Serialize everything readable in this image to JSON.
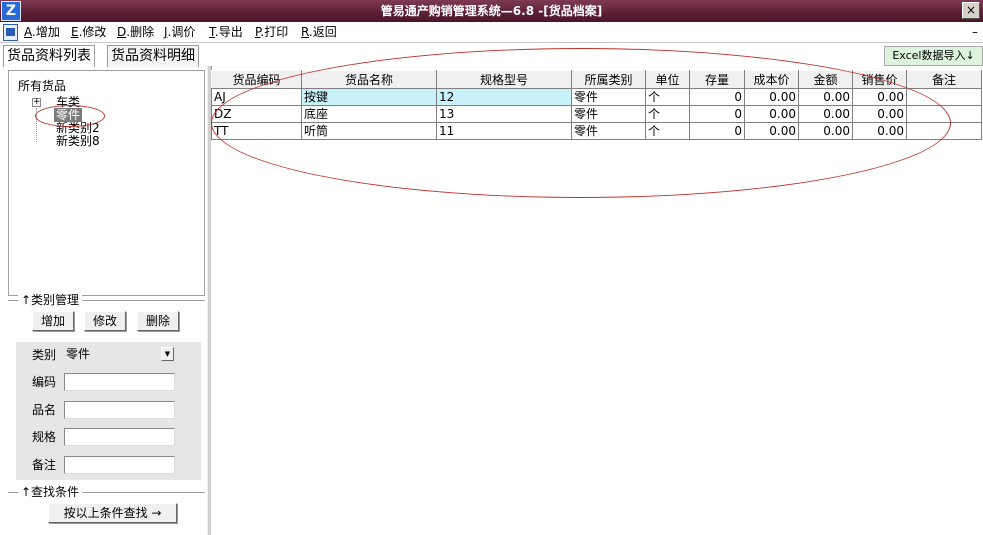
{
  "window": {
    "title": "管易通产购销管理系统—6.8 -[货品档案]",
    "close_label": "×",
    "minimize_label": "–"
  },
  "menu": [
    {
      "hot": "A",
      "label": ".增加"
    },
    {
      "hot": "E",
      "label": ".修改"
    },
    {
      "hot": "D",
      "label": ".删除"
    },
    {
      "hot": "J",
      "label": ".调价"
    },
    {
      "hot": "T",
      "label": ".导出"
    },
    {
      "hot": "P",
      "label": ".打印"
    },
    {
      "hot": "R",
      "label": ".返回"
    }
  ],
  "tabs": [
    {
      "label": "货品资料列表",
      "active": true
    },
    {
      "label": "货品资料明细",
      "active": false
    }
  ],
  "excel_import": "Excel数据导入↓",
  "tree": {
    "root": "所有货品",
    "expander": "+",
    "nodes": [
      "车类",
      "零件",
      "新类别2",
      "新类别8"
    ]
  },
  "category_mgmt": {
    "legend": "↑类别管理",
    "add": "增加",
    "edit": "修改",
    "delete": "删除"
  },
  "filter": {
    "category_label": "类别",
    "category_value": "零件",
    "code_label": "编码",
    "name_label": "品名",
    "spec_label": "规格",
    "note_label": "备注",
    "code_value": "",
    "name_value": "",
    "spec_value": "",
    "note_value": ""
  },
  "search": {
    "legend": "↑查找条件",
    "button": "按以上条件查找 →"
  },
  "table": {
    "headers": [
      "货品编码",
      "货品名称",
      "规格型号",
      "所属类别",
      "单位",
      "存量",
      "成本价",
      "金额",
      "销售价",
      "备注"
    ],
    "rows": [
      [
        "AJ",
        "按键",
        "12",
        "零件",
        "个",
        "0",
        "0.00",
        "0.00",
        "0.00",
        ""
      ],
      [
        "DZ",
        "底座",
        "13",
        "零件",
        "个",
        "0",
        "0.00",
        "0.00",
        "0.00",
        ""
      ],
      [
        "TT",
        "听筒",
        "11",
        "零件",
        "个",
        "0",
        "0.00",
        "0.00",
        "0.00",
        ""
      ]
    ]
  },
  "colors": {
    "titlebar": "#5b1f35",
    "annotation": "#c0302e",
    "selected_cell": "#c9f2fa",
    "excel_button": "#dcf5dc"
  }
}
